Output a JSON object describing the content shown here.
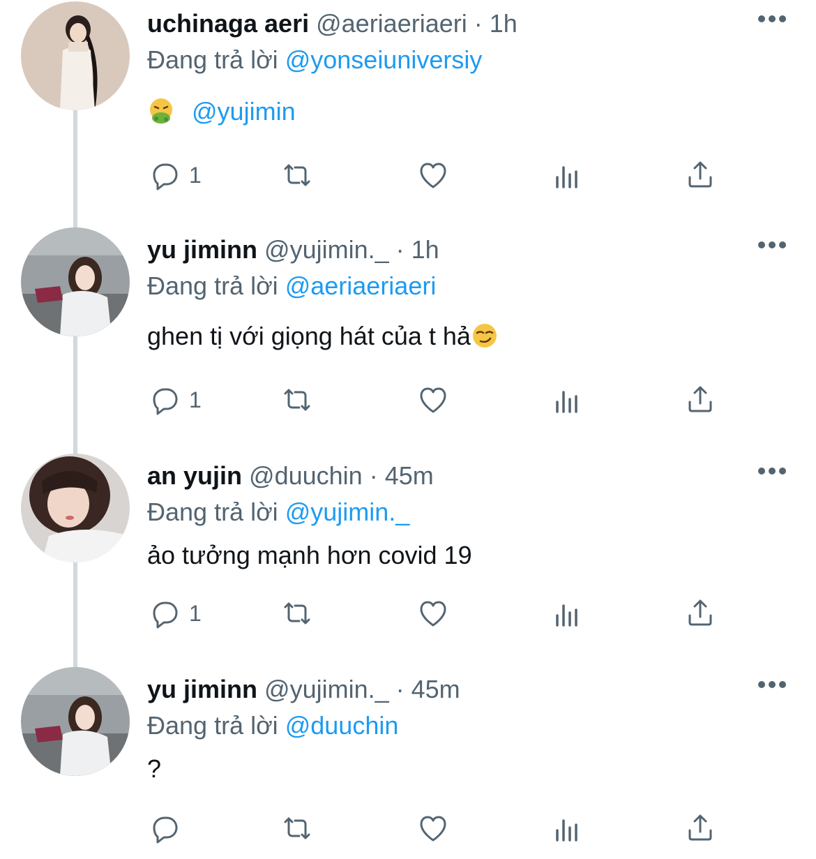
{
  "colors": {
    "text": "#0f1419",
    "muted": "#536471",
    "link": "#1d9bf0",
    "thread": "#cfd9de"
  },
  "tweets": [
    {
      "display_name": "uchinaga aeri",
      "handle": "@aeriaeriaeri",
      "time": "· 1h",
      "replying_label": "Đang trả lời",
      "replying_to": "@yonseiuniversiy",
      "text": "@yujimin",
      "emoji": "nauseated-face",
      "reply_count": "1"
    },
    {
      "display_name": "yu jiminn",
      "handle": "@yujimin._",
      "time": "· 1h",
      "replying_label": "Đang trả lời",
      "replying_to": "@aeriaeriaeri",
      "text": "ghen tị với giọng hát của t hả",
      "emoji": "smirking-face",
      "reply_count": "1"
    },
    {
      "display_name": "an yujin",
      "handle": "@duuchin",
      "time": "· 45m",
      "replying_label": "Đang trả lời",
      "replying_to": "@yujimin._",
      "text": "ảo tưởng mạnh hơn covid 19",
      "reply_count": "1"
    },
    {
      "display_name": "yu jiminn",
      "handle": "@yujimin._",
      "time": "· 45m",
      "replying_label": "Đang trả lời",
      "replying_to": "@duuchin",
      "text": "?",
      "reply_count": ""
    }
  ]
}
